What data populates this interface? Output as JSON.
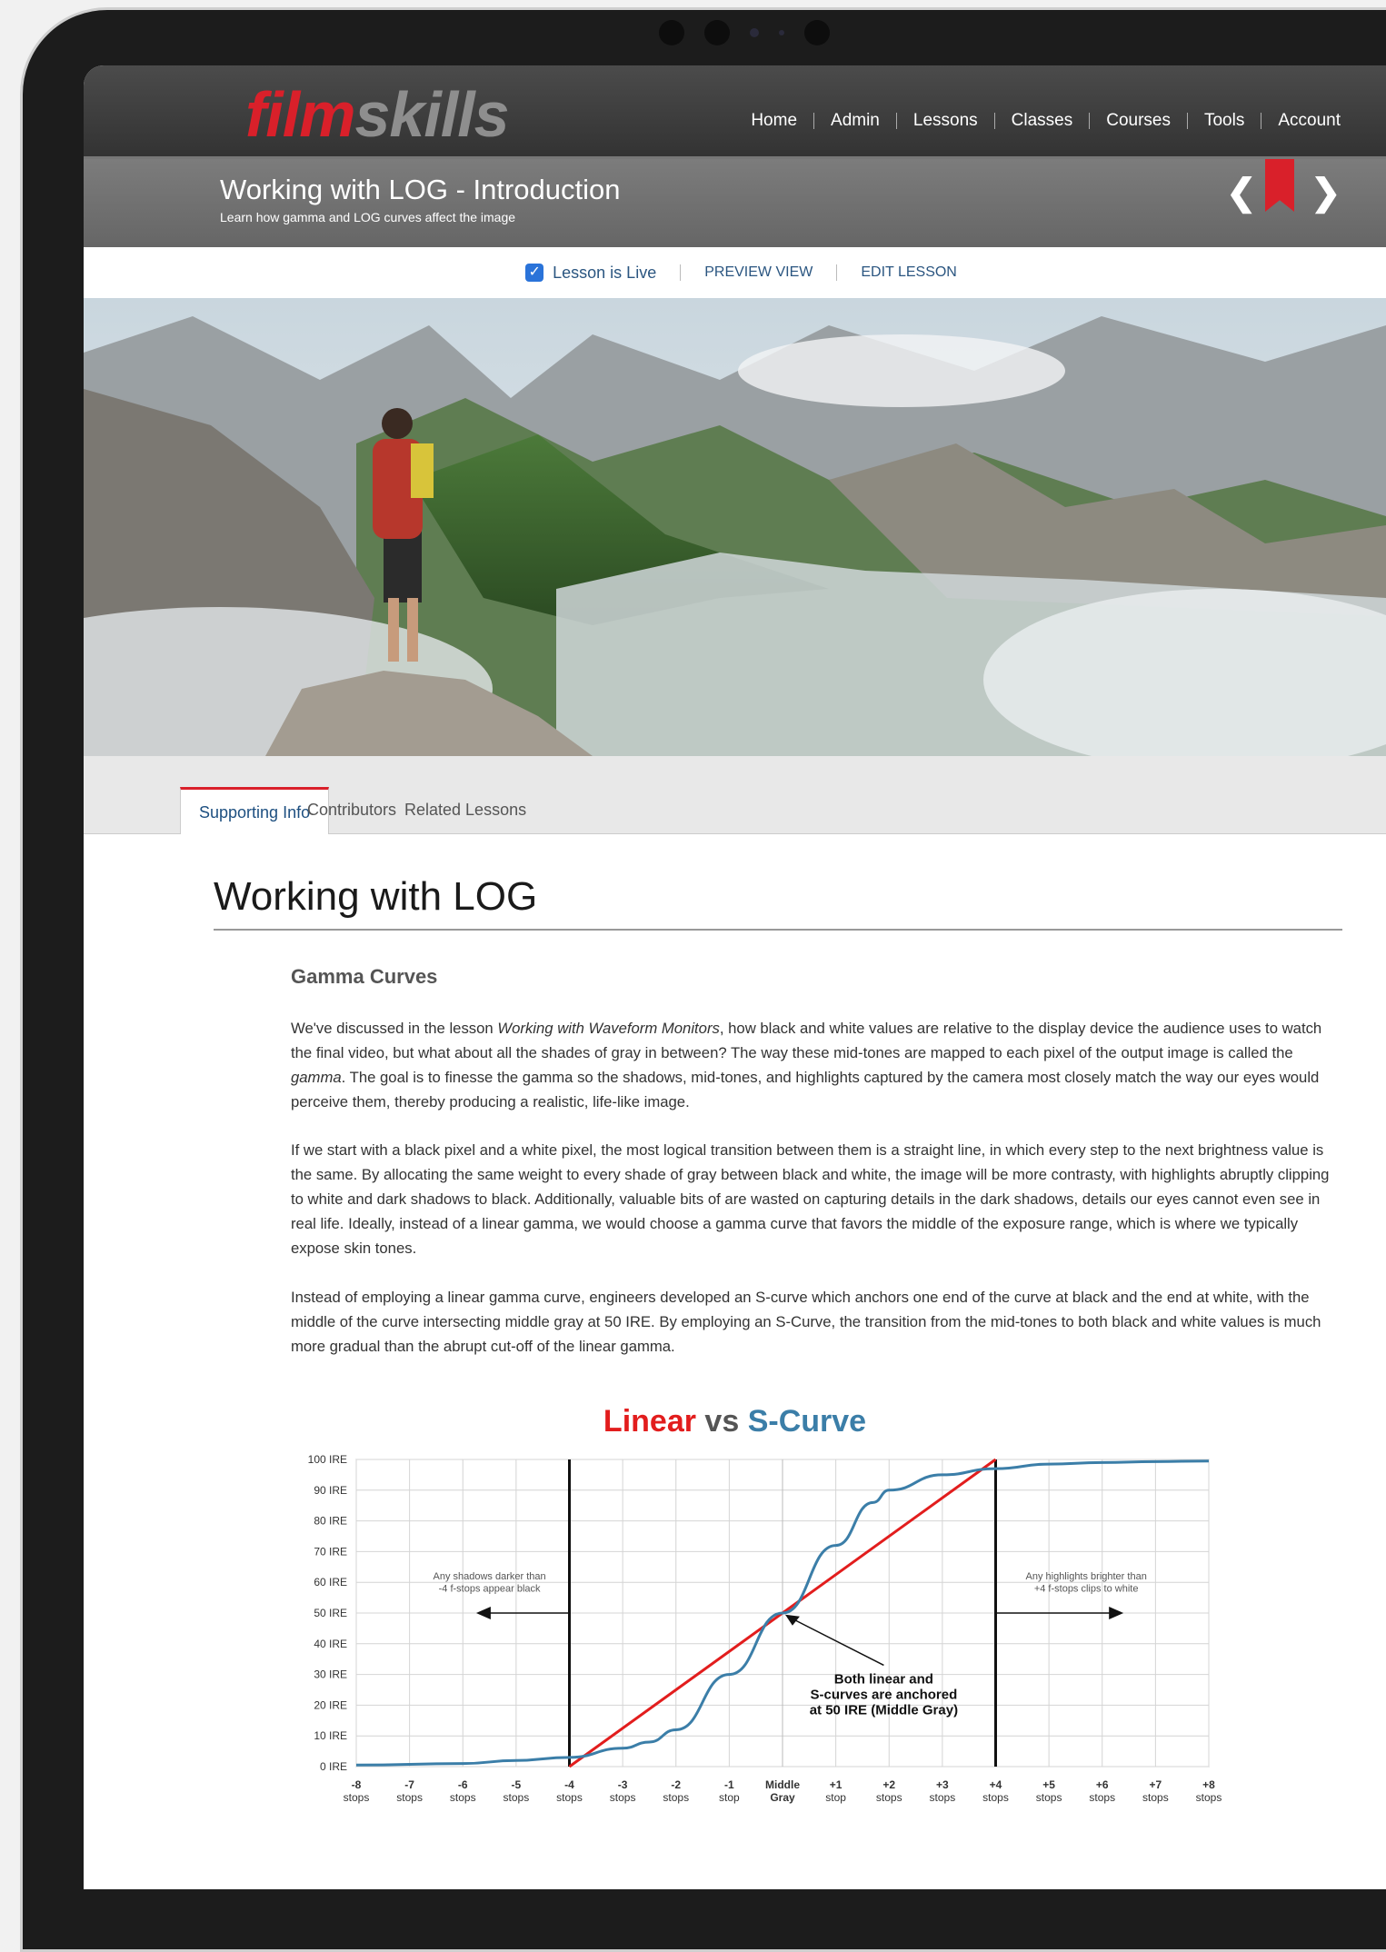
{
  "site": {
    "logo_part1": "film",
    "logo_part2": "skills"
  },
  "nav": [
    "Home",
    "Admin",
    "Lessons",
    "Classes",
    "Courses",
    "Tools",
    "Account"
  ],
  "lesson": {
    "title": "Working with LOG - Introduction",
    "subtitle": "Learn how gamma and LOG curves affect the image",
    "live_label": "Lesson is Live",
    "preview_label": "PREVIEW VIEW",
    "edit_label": "EDIT LESSON",
    "live_checked": true
  },
  "tabs": [
    "Supporting Info",
    "Contributors",
    "Related Lessons"
  ],
  "content": {
    "heading": "Working with LOG",
    "subheading": "Gamma Curves",
    "p1": "We've discussed in the lesson Working with Waveform Monitors, how black and white values are relative to the display device the audience uses to watch the final video, but what about all the shades of gray in between?  The way these mid-tones are mapped to each pixel of the output image is called the gamma. The goal is to finesse the gamma so the shadows, mid-tones, and highlights captured by the camera most closely match the way our eyes would perceive them, thereby producing a realistic, life-like image.",
    "p2": "If we start with a black pixel and a white pixel, the most logical transition between them is a straight line, in which every step to the next brightness value is the same. By allocating the same weight to every shade of gray between black and white, the image will be more contrasty, with highlights abruptly clipping to white and dark shadows to black. Additionally, valuable bits of are wasted on capturing details in the dark shadows, details our eyes cannot even see in real life. Ideally, instead of a linear gamma, we would choose a gamma curve that favors the middle of the exposure range, which is where we typically expose skin tones.",
    "p3": "Instead of employing a linear gamma curve, engineers developed an S-curve which anchors one end of the curve at black and the end at white, with the middle of the curve intersecting middle gray at 50 IRE. By employing an S-Curve, the transition from the mid-tones to both black and white values is much more gradual than the abrupt cut-off of the linear gamma."
  },
  "chart_data": {
    "type": "line",
    "title_part1": "Linear",
    "title_part2": "vs",
    "title_part3": "S-Curve",
    "yticks": [
      "100 IRE",
      "90 IRE",
      "80 IRE",
      "70 IRE",
      "60 IRE",
      "50 IRE",
      "40 IRE",
      "30 IRE",
      "20 IRE",
      "10 IRE",
      "0 IRE"
    ],
    "x": [
      -8,
      -7,
      -6,
      -5,
      -4,
      -3,
      -2,
      -1,
      0,
      1,
      2,
      3,
      4,
      5,
      6,
      7,
      8
    ],
    "xticks": [
      [
        "-8",
        "stops"
      ],
      [
        "-7",
        "stops"
      ],
      [
        "-6",
        "stops"
      ],
      [
        "-5",
        "stops"
      ],
      [
        "-4",
        "stops"
      ],
      [
        "-3",
        "stops"
      ],
      [
        "-2",
        "stops"
      ],
      [
        "-1",
        "stop"
      ],
      [
        "Middle",
        "Gray"
      ],
      [
        "+1",
        "stop"
      ],
      [
        "+2",
        "stops"
      ],
      [
        "+3",
        "stops"
      ],
      [
        "+4",
        "stops"
      ],
      [
        "+5",
        "stops"
      ],
      [
        "+6",
        "stops"
      ],
      [
        "+7",
        "stops"
      ],
      [
        "+8",
        "stops"
      ]
    ],
    "ylim": [
      0,
      100
    ],
    "series": [
      {
        "name": "Linear",
        "color": "#e21d1d",
        "x": [
          -4,
          4
        ],
        "y": [
          0,
          100
        ]
      },
      {
        "name": "S-Curve",
        "color": "#3b7ea8",
        "x": [
          -8,
          -6,
          -5,
          -4,
          -3,
          -2.5,
          -2,
          -1,
          0,
          1,
          1.7,
          2,
          3,
          4,
          5,
          6,
          7,
          8
        ],
        "y": [
          0.5,
          1,
          2,
          3,
          6,
          8,
          12,
          30,
          50,
          72,
          86,
          90,
          95,
          97,
          98.5,
          99,
          99.3,
          99.5
        ]
      }
    ],
    "annotations": {
      "left_line1": "Any shadows darker than",
      "left_line2": "-4 f-stops appear black",
      "right_line1": "Any highlights brighter than",
      "right_line2": "+4 f-stops clips to white",
      "center_line1": "Both linear and",
      "center_line2": "S-curves are anchored",
      "center_line3": "at 50 IRE (Middle Gray)"
    },
    "grid": true
  }
}
